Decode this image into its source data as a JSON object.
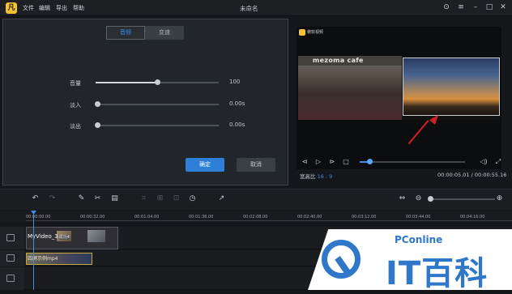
{
  "app": {
    "title": "未命名",
    "menus": [
      "文件",
      "编辑",
      "导出",
      "帮助"
    ]
  },
  "audio_panel": {
    "tabs": [
      "音频",
      "变速"
    ],
    "active_tab": "音频",
    "params": [
      {
        "label": "音量",
        "value": "100",
        "level": 0.5
      },
      {
        "label": "淡入",
        "value": "0.00s",
        "level": 0.0
      },
      {
        "label": "淡出",
        "value": "0.00s",
        "level": 0.0
      }
    ],
    "ok_label": "确定",
    "cancel_label": "取消"
  },
  "preview": {
    "brand": "傲软视频",
    "sign_text": "mezoma cafe",
    "aspect_label": "宽高比",
    "aspect_value": "16 : 9",
    "timecode": "00:00:05.01 / 00:00:55.16",
    "progress": 0.09
  },
  "timeline": {
    "ruler": [
      "00:00:00.00",
      "00:00:32.00",
      "00:01:04.00",
      "00:01:36.00",
      "00:02:08.00",
      "00:02:40.00",
      "00:03:12.00",
      "00:03:44.00",
      "00:04:16.00"
    ],
    "clips": [
      {
        "name": "MyVideo_3",
        "badge": "成功4"
      },
      {
        "name": "四屏示例mp4"
      }
    ]
  },
  "watermark": {
    "brand": "PConline",
    "big": "IT百科"
  },
  "colors": {
    "accent": "#3b8fe6",
    "ok_button": "#2d7fd8",
    "logo": "#f2c230",
    "arrow": "#d02020",
    "watermark_blue": "#2f77c9"
  }
}
